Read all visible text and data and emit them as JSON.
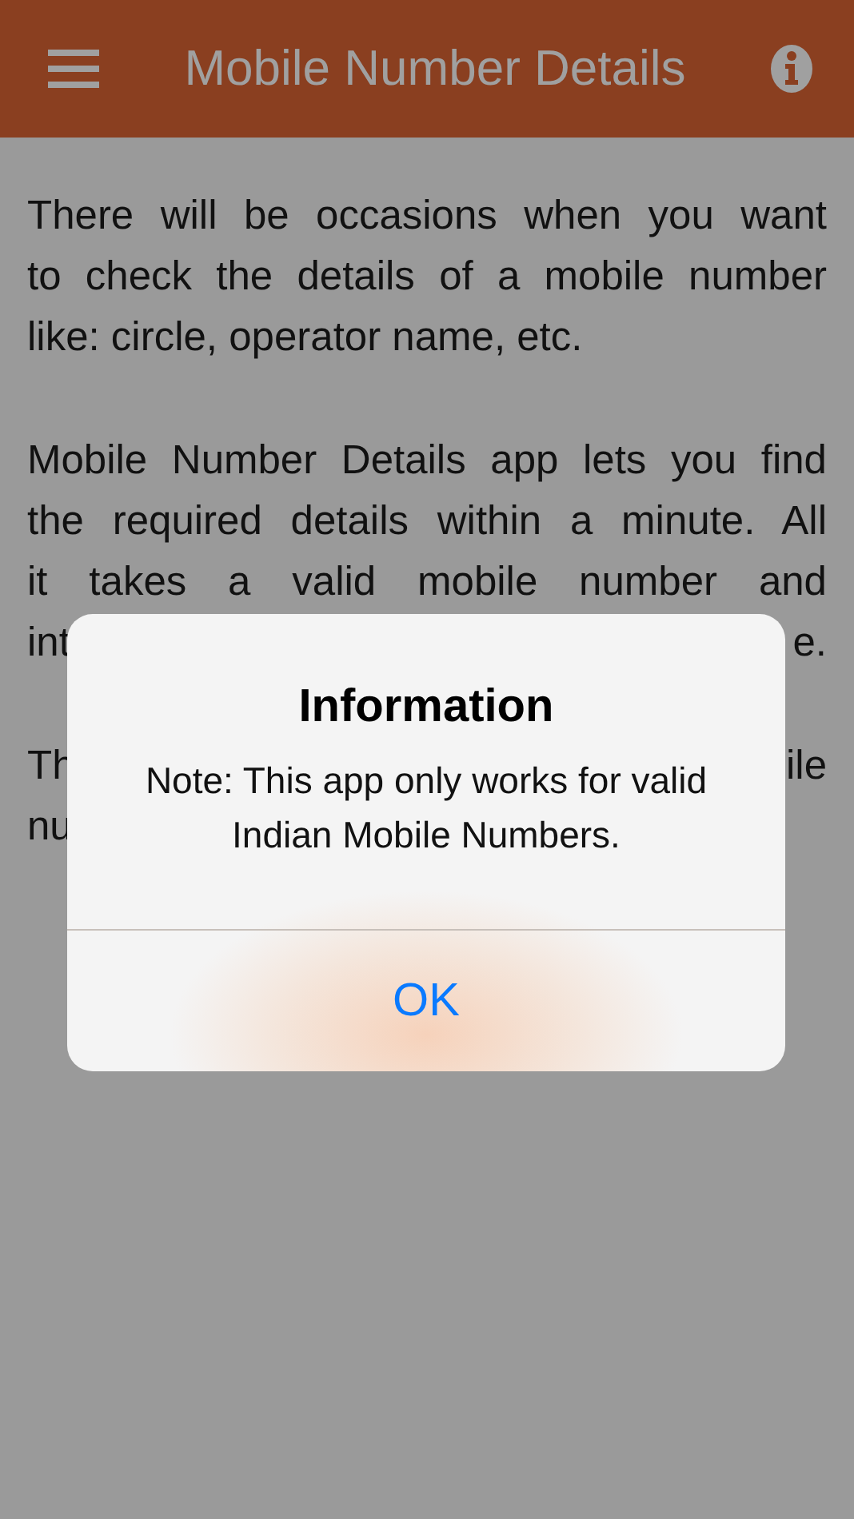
{
  "header": {
    "title": "Mobile Number Details"
  },
  "paragraphs": [
    {
      "lines": [
        "There will be occasions when you want",
        "to check the details of a mobile number",
        "like: circle, operator name, etc."
      ]
    },
    {
      "lines": [
        "Mobile Number Details app lets you find",
        "the required details within a minute. All",
        "it takes a valid mobile number and"
      ]
    }
  ],
  "partial_paragraphs": [
    {
      "lines": [
        {
          "left": "int",
          "right": "e."
        }
      ]
    },
    {
      "lines": [
        {
          "left": "Th",
          "right": "ile"
        },
        {
          "left": "nu"
        }
      ]
    }
  ],
  "dialog": {
    "title": "Information",
    "message": "Note: This app only works for valid Indian Mobile Numbers.",
    "button": "OK"
  }
}
